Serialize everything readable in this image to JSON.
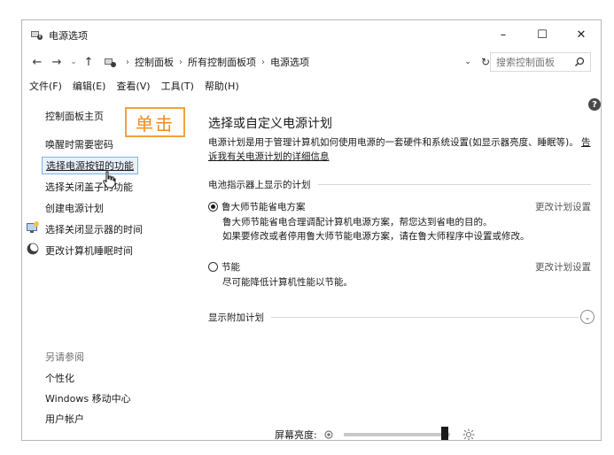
{
  "window": {
    "title": "电源选项",
    "controls": {
      "minimize": "–",
      "maximize": "☐",
      "close": "✕"
    }
  },
  "address": {
    "breadcrumbs": [
      "控制面板",
      "所有控制面板项",
      "电源选项"
    ],
    "search_placeholder": "搜索控制面板"
  },
  "menu": [
    "文件(F)",
    "编辑(E)",
    "查看(V)",
    "工具(T)",
    "帮助(H)"
  ],
  "sidebar": {
    "links": [
      {
        "label": "控制面板主页"
      },
      {
        "label": "唤醒时需要密码"
      },
      {
        "label": "选择电源按钮的功能"
      },
      {
        "label": "选择关闭盖子的功能"
      },
      {
        "label": "创建电源计划"
      },
      {
        "label": "选择关闭显示器的时间"
      },
      {
        "label": "更改计算机睡眠时间"
      }
    ],
    "see_also_heading": "另请参阅",
    "see_also": [
      {
        "label": "个性化"
      },
      {
        "label": "Windows 移动中心"
      },
      {
        "label": "用户帐户"
      }
    ]
  },
  "callout": {
    "label": "单击"
  },
  "main": {
    "title": "选择或自定义电源计划",
    "description": "电源计划是用于管理计算机如何使用电源的一套硬件和系统设置(如显示器亮度、睡眠等)。",
    "description_link": "告诉我有关电源计划的详细信息",
    "battery_section": "电池指示器上显示的计划",
    "plans": [
      {
        "name": "鲁大师节能省电方案",
        "selected": true,
        "change_link": "更改计划设置",
        "desc_lines": [
          "鲁大师节能省电合理调配计算机电源方案，帮您达到省电的目的。",
          "如果要修改或者停用鲁大师节能电源方案，请在鲁大师程序中设置或修改。"
        ]
      },
      {
        "name": "节能",
        "selected": false,
        "change_link": "更改计划设置",
        "desc_lines": [
          "尽可能降低计算机性能以节能。"
        ]
      }
    ],
    "additional_section": "显示附加计划",
    "brightness_label": "屏幕亮度:",
    "brightness_level": 0.95
  },
  "colors": {
    "callout_orange": "#ef8b1e",
    "selection_border": "#7fb2e5",
    "selection_bg": "#e8f1fb"
  }
}
